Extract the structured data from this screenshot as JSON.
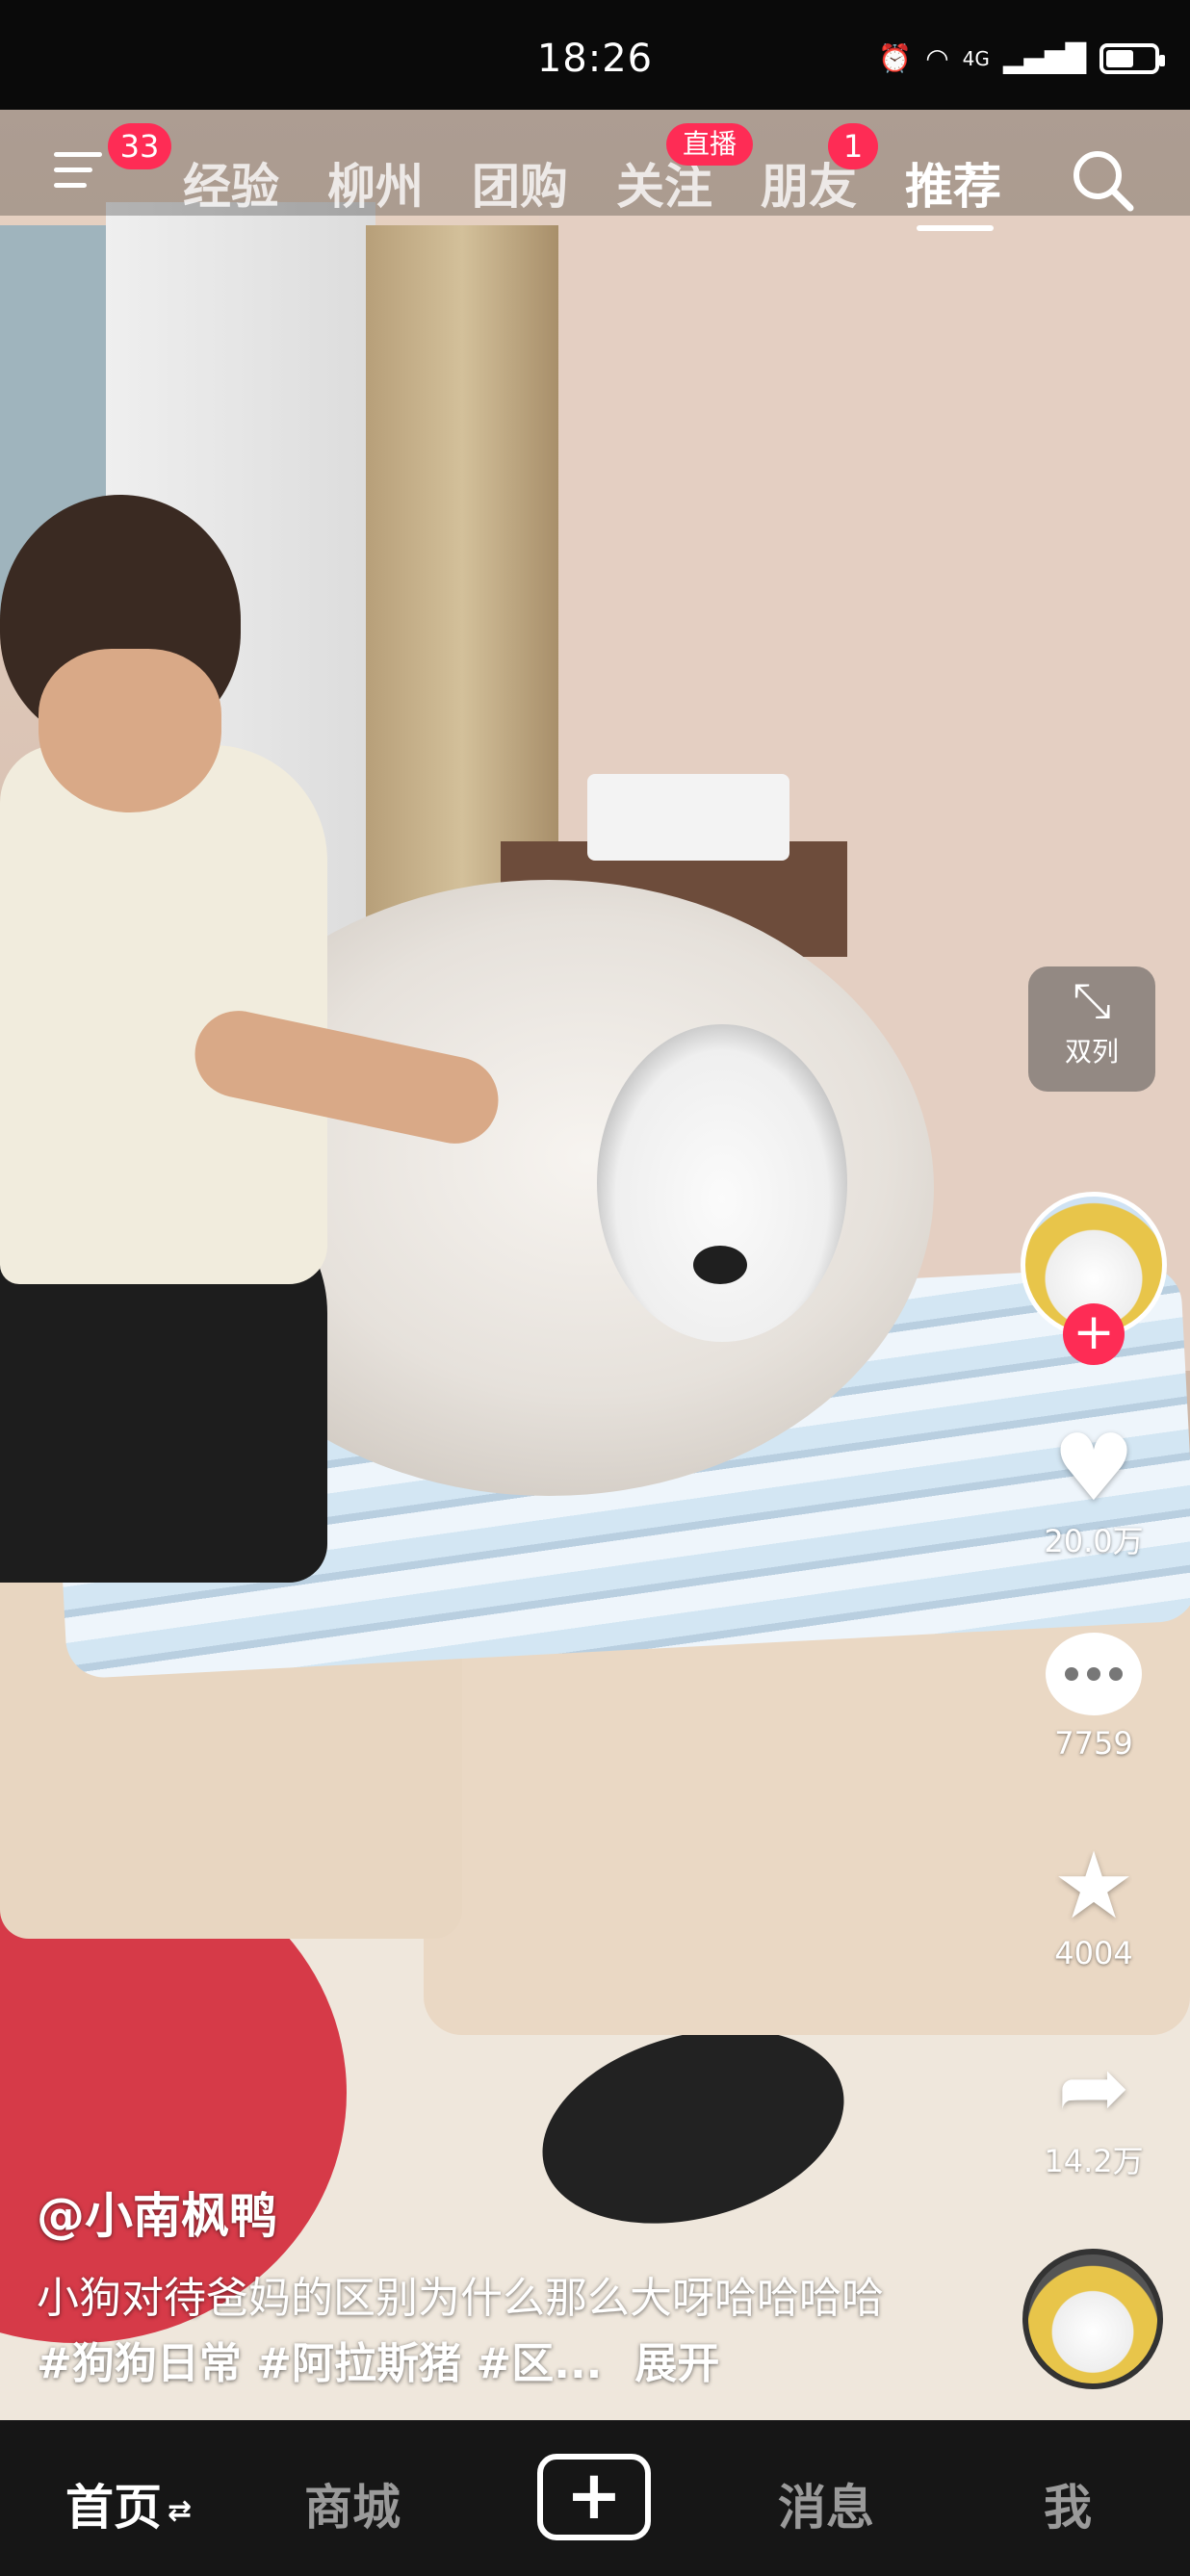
{
  "status_bar": {
    "time": "18:26",
    "network": "4G",
    "battery_level": 0.55
  },
  "top_nav": {
    "menu_badge": "33",
    "tabs": [
      {
        "label": "经验"
      },
      {
        "label": "柳州"
      },
      {
        "label": "团购"
      },
      {
        "label": "关注",
        "badge": "直播"
      },
      {
        "label": "朋友",
        "badge": "1"
      },
      {
        "label": "推荐",
        "active": true
      }
    ]
  },
  "video": {
    "dual_column_label": "双列",
    "likes": "20.0万",
    "comments": "7759",
    "favorites": "4004",
    "shares": "14.2万",
    "author": "@小南枫鸭",
    "caption_text": "小狗对待爸妈的区别为什么那么大呀哈哈哈哈",
    "caption_tags": "#狗狗日常 #阿拉斯猪 #区...",
    "expand_label": "展开"
  },
  "bottom_nav": {
    "items": [
      {
        "label": "首页",
        "active": true
      },
      {
        "label": "商城"
      },
      {
        "label": "消息"
      },
      {
        "label": "我"
      }
    ],
    "create_glyph": "+"
  }
}
